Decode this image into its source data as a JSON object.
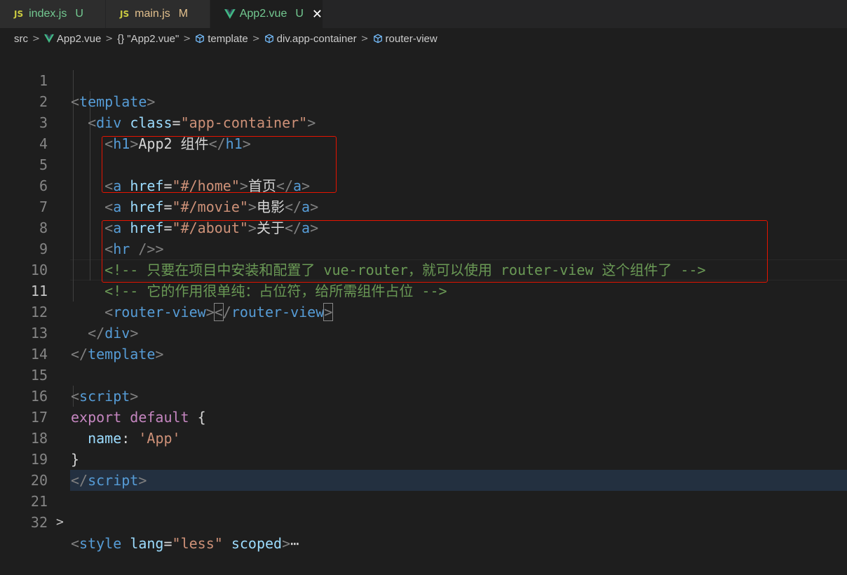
{
  "tabs": [
    {
      "icon": "JS",
      "name": "index.js",
      "status": "U"
    },
    {
      "icon": "JS",
      "name": "main.js",
      "status": "M"
    },
    {
      "icon": "vue",
      "name": "App2.vue",
      "status": "U",
      "close": "✕"
    }
  ],
  "breadcrumbs": [
    "src",
    "App2.vue",
    "\"App2.vue\"",
    "template",
    "div.app-container",
    "router-view"
  ],
  "breadcrumb_icons": {
    "braces": "{}"
  },
  "lines": {
    "1": "1",
    "2": "2",
    "3": "3",
    "4": "4",
    "5": "5",
    "6": "6",
    "7": "7",
    "8": "8",
    "9": "9",
    "10": "10",
    "11": "11",
    "12": "12",
    "13": "13",
    "14": "14",
    "15": "15",
    "16": "16",
    "17": "17",
    "18": "18",
    "19": "19",
    "20": "20",
    "21": "21",
    "22": "32"
  },
  "code": {
    "l1_tag": "template",
    "l2_tag": "div",
    "l2_attr": "class",
    "l2_val": "\"app-container\"",
    "l3_tag": "h1",
    "l3_text": "App2 组件",
    "l3_close": "h1",
    "l5_tag": "a",
    "l5_attr": "href",
    "l5_val": "\"#/home\"",
    "l5_text": "首页",
    "l5_close": "a",
    "l6_tag": "a",
    "l6_attr": "href",
    "l6_val": "\"#/movie\"",
    "l6_text": "电影",
    "l6_close": "a",
    "l7_tag": "a",
    "l7_attr": "href",
    "l7_val": "\"#/about\"",
    "l7_text": "关于",
    "l7_close": "a",
    "l8_tag": "hr",
    "l8_slash": " />",
    "l9_comment": "<!-- 只要在项目中安装和配置了 vue-router，就可以使用 router-view 这个组件了 -->",
    "l10_comment": "<!-- 它的作用很单纯：占位符，给所需组件占位 -->",
    "l11_tag": "router-view",
    "l11_close": "router-view",
    "l12_tag": "div",
    "l13_tag": "template",
    "l15_tag": "script",
    "l16_kw1": "export",
    "l16_kw2": "default",
    "l16_brace": " {",
    "l17_key": "name",
    "l17_colon": ": ",
    "l17_val": "'App'",
    "l18_brace": "}",
    "l19_tag": "script",
    "l21_tag": "style",
    "l21_attr1": "lang",
    "l21_val": "\"less\"",
    "l21_attr2": "scoped",
    "l21_ellipsis": "⋯"
  },
  "colors": {
    "accent_red": "#e51400",
    "tag": "#569cd6",
    "attr": "#9cdcfe",
    "string": "#ce9178",
    "comment": "#6a9955",
    "keyword": "#c586c0",
    "vue_green": "#41b883"
  }
}
